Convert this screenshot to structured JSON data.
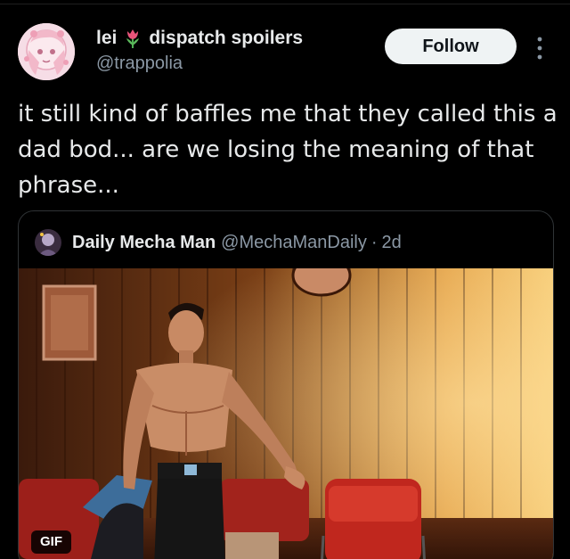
{
  "author": {
    "name_part1": "lei",
    "name_emoji": "tulip-emoji",
    "name_part2": "dispatch spoilers",
    "handle": "@trappolia"
  },
  "actions": {
    "follow_label": "Follow",
    "more_icon": "vertical-dots-icon"
  },
  "tweet": {
    "text": "it still kind of baffles me that they called this a dad bod... are we losing the meaning of that phrase..."
  },
  "quote": {
    "name": "Daily Mecha Man",
    "handle": "@MechaManDaily",
    "separator": "·",
    "age": "2d",
    "media_badge": "GIF"
  },
  "colors": {
    "background": "#000000",
    "text_primary": "#e7e9ea",
    "text_secondary": "#8b98a5",
    "follow_bg": "#eff3f4",
    "follow_text": "#0f1419",
    "border": "#2f3336"
  }
}
